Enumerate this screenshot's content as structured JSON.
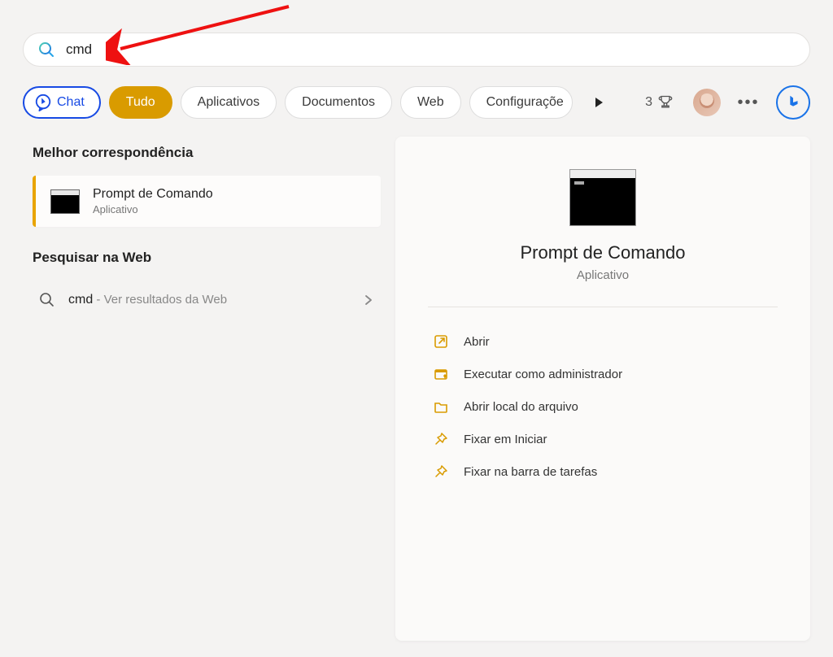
{
  "annotation_arrow": {
    "color": "#e11"
  },
  "search": {
    "value": "cmd"
  },
  "tabs": {
    "chat": "Chat",
    "all": "Tudo",
    "apps": "Aplicativos",
    "docs": "Documentos",
    "web": "Web",
    "settings": "Configuraçõe"
  },
  "rewards": {
    "points": "3"
  },
  "left": {
    "best_match_header": "Melhor correspondência",
    "best_match": {
      "title": "Prompt de Comando",
      "subtitle": "Aplicativo"
    },
    "web_search_header": "Pesquisar na Web",
    "web_result": {
      "query": "cmd",
      "suffix": " - Ver resultados da Web"
    }
  },
  "right": {
    "title": "Prompt de Comando",
    "subtitle": "Aplicativo",
    "actions": [
      {
        "icon": "open",
        "label": "Abrir"
      },
      {
        "icon": "admin",
        "label": "Executar como administrador"
      },
      {
        "icon": "folder",
        "label": "Abrir local do arquivo"
      },
      {
        "icon": "pin",
        "label": "Fixar em Iniciar"
      },
      {
        "icon": "pin",
        "label": "Fixar na barra de tarefas"
      }
    ]
  }
}
